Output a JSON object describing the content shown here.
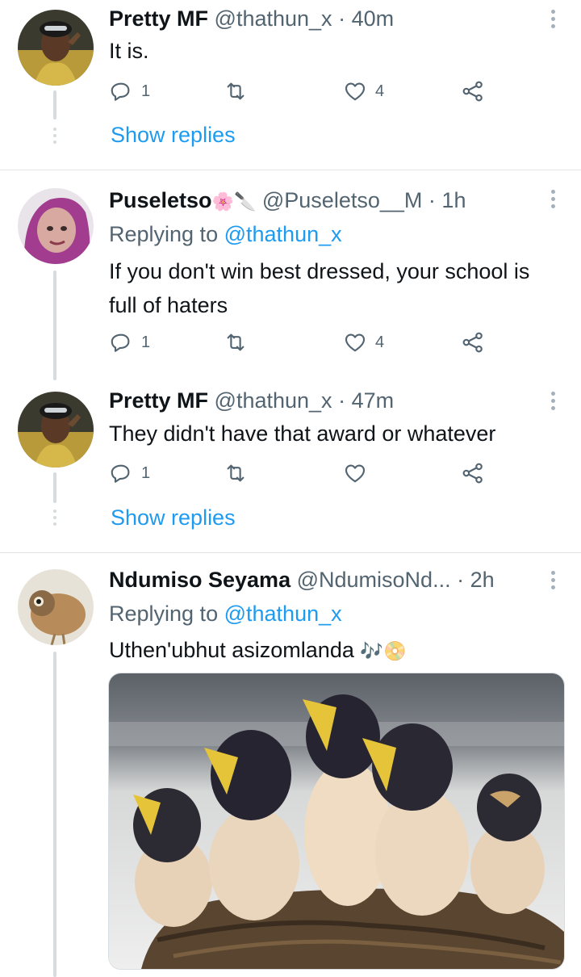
{
  "tweets": [
    {
      "name": "Pretty MF",
      "handle": "@thathun_x",
      "time": "40m",
      "text": "It is.",
      "reply_count": "1",
      "like_count": "4",
      "show_replies": "Show replies"
    },
    {
      "name": "Puseletso",
      "name_emoji": "🌸🔪",
      "handle": "@Puseletso__M",
      "time": "1h",
      "replying_prefix": "Replying to",
      "replying_to": "@thathun_x",
      "text": "If you don't win best dressed, your school is full of haters",
      "reply_count": "1",
      "like_count": "4"
    },
    {
      "name": "Pretty MF",
      "handle": "@thathun_x",
      "time": "47m",
      "text": "They didn't have that award or whatever",
      "reply_count": "1",
      "like_count": "",
      "show_replies": "Show replies"
    },
    {
      "name": "Ndumiso Seyama",
      "handle": "@NdumisoNd...",
      "time": "2h",
      "replying_prefix": "Replying to",
      "replying_to": "@thathun_x",
      "text": "Uthen'ubhut asizomlanda",
      "text_emoji": "🎶📀",
      "media": "baby swallows photo"
    }
  ],
  "separator": "·",
  "colors": {
    "link": "#1d9bf0",
    "secondary": "#536471",
    "line": "#d6dbdf"
  },
  "icons": [
    "reply-icon",
    "retweet-icon",
    "like-icon",
    "share-icon",
    "more-icon"
  ]
}
